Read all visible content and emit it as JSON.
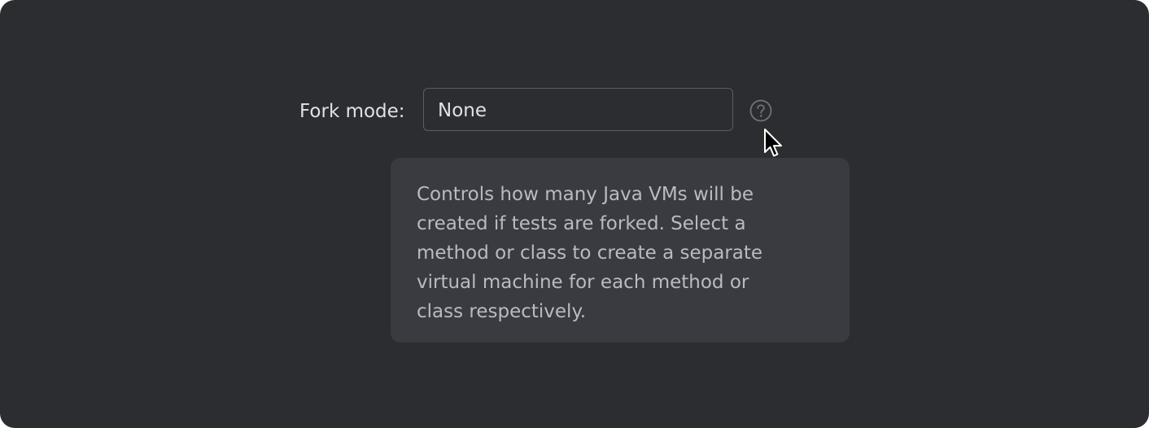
{
  "fork_mode": {
    "label": "Fork mode:",
    "value": "None",
    "help_icon": "question-circle-icon"
  },
  "tooltip": {
    "lines": [
      "Controls how many Java VMs will be",
      "created if tests are forked. Select a",
      "method or class to create a separate",
      "virtual machine for each method or",
      "class respectively."
    ]
  },
  "colors": {
    "background": "#2b2d30",
    "tooltip_background": "#393b40",
    "text": "#dfe1e5",
    "tooltip_text": "#b9bbc0",
    "border": "#5a5d63"
  }
}
